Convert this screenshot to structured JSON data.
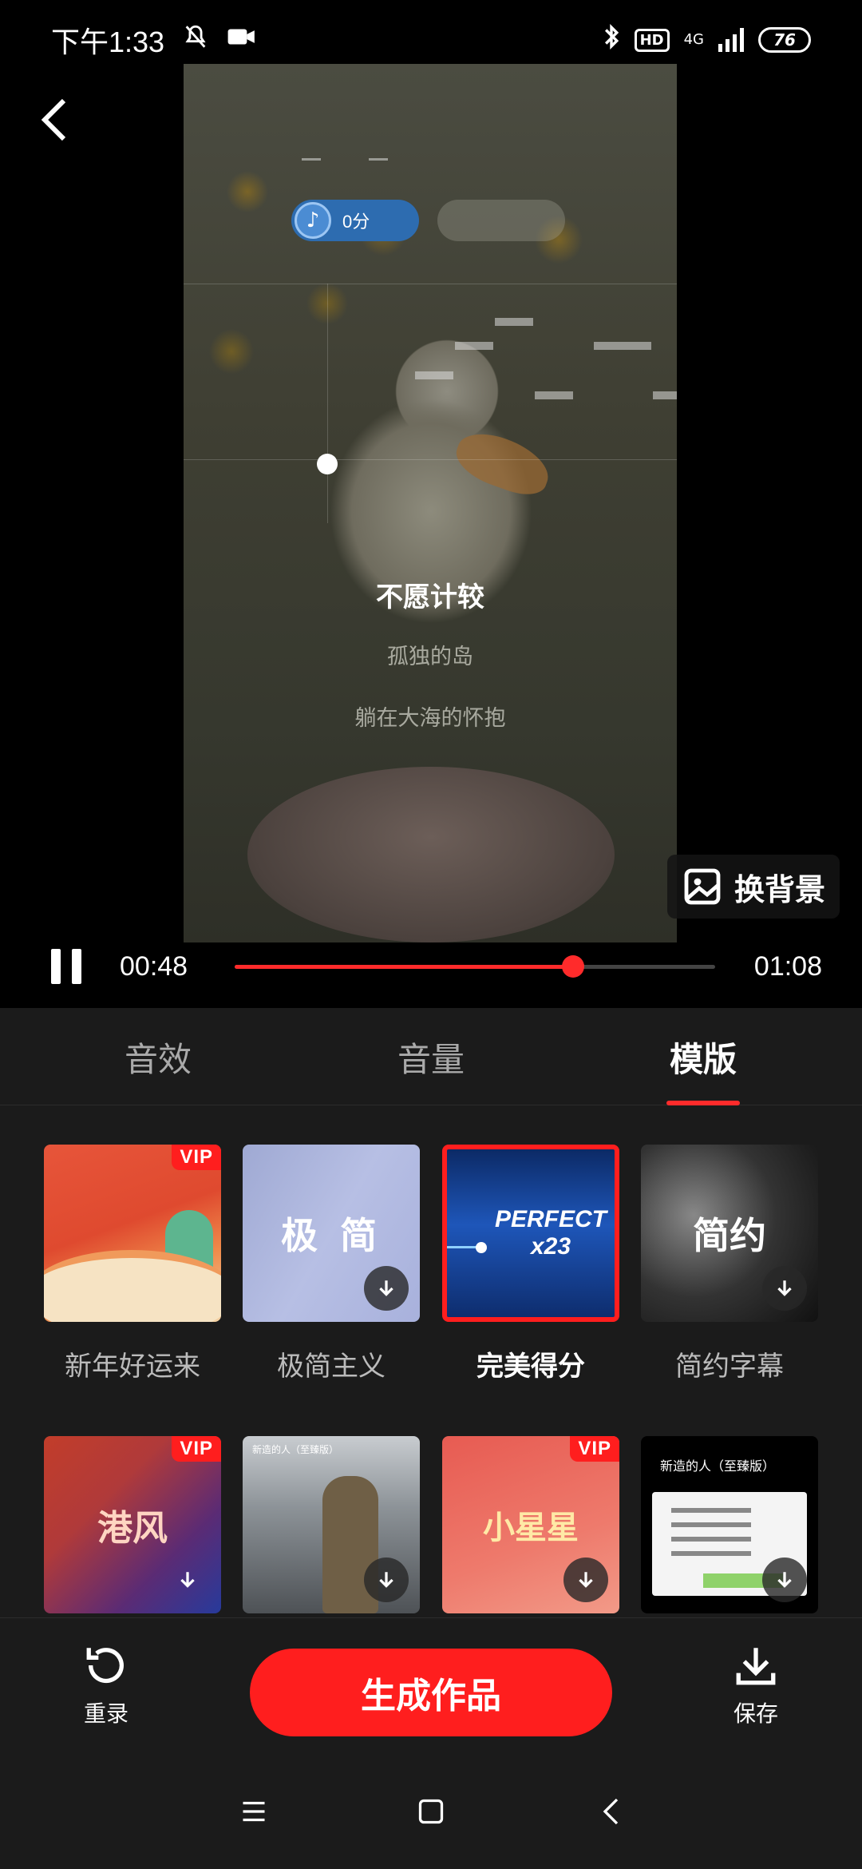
{
  "status_bar": {
    "time": "下午1:33",
    "hd": "HD",
    "network": "4G",
    "battery": "76"
  },
  "preview": {
    "score": "0分",
    "lyrics": {
      "current": "不愿计较",
      "next1": "孤独的岛",
      "next2": "躺在大海的怀抱"
    },
    "change_background": "换背景"
  },
  "playback": {
    "current_time": "00:48",
    "total_time": "01:08",
    "progress": 0.705
  },
  "tabs": [
    {
      "label": "音效",
      "active": false
    },
    {
      "label": "音量",
      "active": false
    },
    {
      "label": "模版",
      "active": true
    }
  ],
  "templates": [
    {
      "label": "新年好运来",
      "vip": "VIP",
      "thumb_text": "",
      "selected": false
    },
    {
      "label": "极简主义",
      "vip": "",
      "thumb_text": "极 简",
      "selected": false
    },
    {
      "label": "完美得分",
      "vip": "",
      "thumb_text": "PERFECT x23",
      "selected": true
    },
    {
      "label": "简约字幕",
      "vip": "",
      "thumb_text": "简约",
      "selected": false
    },
    {
      "label": "",
      "vip": "VIP",
      "thumb_text": "港风",
      "selected": false
    },
    {
      "label": "",
      "vip": "",
      "thumb_text": "新造的人（至臻版）",
      "selected": false
    },
    {
      "label": "",
      "vip": "VIP",
      "thumb_text": "小星星",
      "selected": false
    },
    {
      "label": "",
      "vip": "",
      "thumb_text": "新造的人（至臻版）",
      "selected": false
    }
  ],
  "actions": {
    "rerecord": "重录",
    "generate": "生成作品",
    "save": "保存"
  },
  "colors": {
    "accent": "#ff1e1e",
    "panel_bg": "#1b1b1b"
  }
}
